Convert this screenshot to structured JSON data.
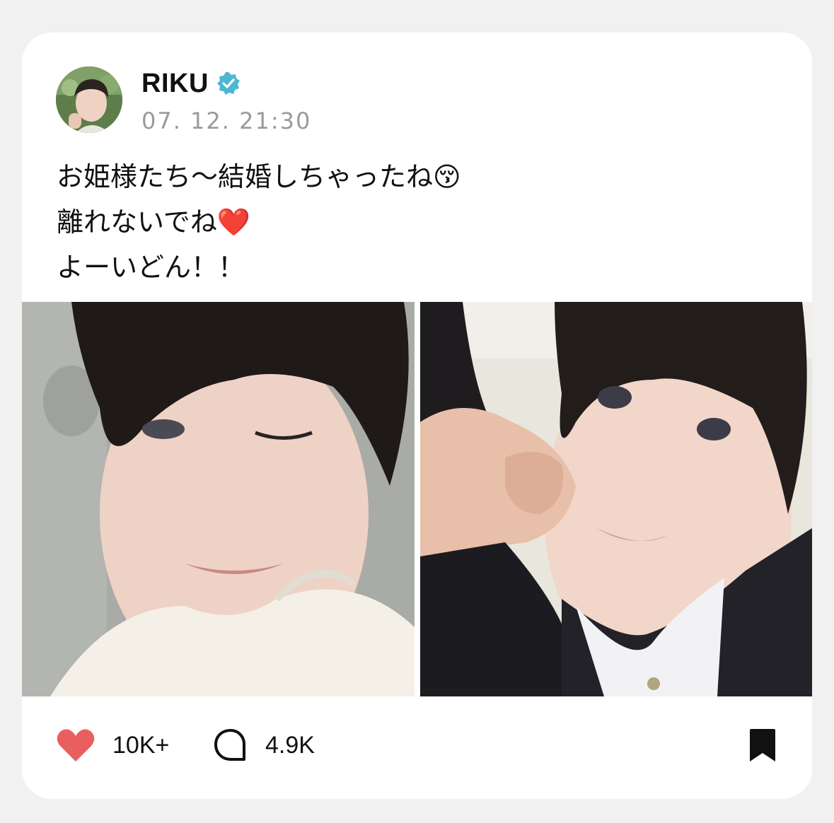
{
  "post": {
    "username": "RIKU",
    "verified": true,
    "timestamp": "07. 12. 21:30",
    "text_lines": [
      "お姫様たち～結婚しちゃったね😚",
      "離れないでね❤️",
      "よーいどん！！"
    ],
    "images": [
      {
        "icon": "selfie-wink-photo"
      },
      {
        "icon": "selfie-fist-photo"
      }
    ],
    "likes": "10K+",
    "comments": "4.9K"
  },
  "colors": {
    "heart": "#e95f5f",
    "verified": "#4ab8d3",
    "text": "#111111",
    "timestamp": "#9a9a9a"
  }
}
